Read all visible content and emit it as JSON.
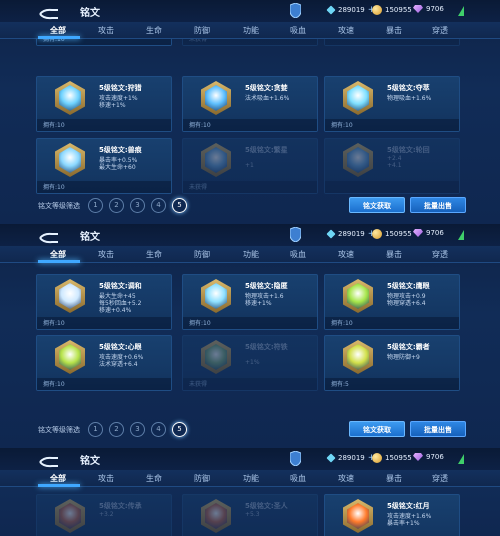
{
  "header": {
    "title": "铭文",
    "diamonds": "289019",
    "coins": "150955",
    "gems": "9706"
  },
  "tabs": [
    "全部",
    "攻击",
    "生命",
    "防御",
    "功能",
    "吸血",
    "攻速",
    "暴击",
    "穿透"
  ],
  "filter": {
    "label": "铭文等级筛选",
    "levels": [
      "1",
      "2",
      "3",
      "4",
      "5"
    ],
    "active_level": "5",
    "get_button": "铭文获取",
    "sell_button": "批量出售"
  },
  "colors": {
    "accent": "#3fa8ff",
    "bg": "#112c57"
  },
  "screens": [
    {
      "partial_row": [
        {
          "name": "",
          "stats": [],
          "owned": "拥有:10",
          "dim": false,
          "color": "#3a5f8f",
          "icon": "rune-icon"
        },
        {
          "name": "",
          "stats": [],
          "owned": "未获得",
          "dim": true,
          "color": "#3a5f8f",
          "icon": "rune-icon"
        },
        {
          "name": "",
          "stats": [
            "+4"
          ],
          "owned": "",
          "dim": true,
          "color": "#3a5f8f",
          "icon": "rune-icon"
        }
      ],
      "cards": [
        {
          "name": "5级铭文:狩猎",
          "stats": [
            "攻击速度+1%",
            "移速+1%"
          ],
          "owned": "拥有:10",
          "dim": false,
          "color": "#6fd3ff",
          "icon": "hunt-rune-icon"
        },
        {
          "name": "5级铭文:贪婪",
          "stats": [
            "法术吸血+1.6%"
          ],
          "owned": "拥有:10",
          "dim": false,
          "color": "#5ec0ff",
          "icon": "greed-rune-icon"
        },
        {
          "name": "5级铭文:夺萃",
          "stats": [
            "物理吸血+1.6%"
          ],
          "owned": "拥有:10",
          "dim": false,
          "color": "#7fe0ff",
          "icon": "plunder-rune-icon"
        },
        {
          "name": "5级铭文:兽痕",
          "stats": [
            "暴击率+0.5%",
            "最大生命+60"
          ],
          "owned": "拥有:10",
          "dim": false,
          "color": "#8bd8ff",
          "icon": "beast-rune-icon"
        },
        {
          "name": "5级铭文:繁星",
          "stats": [
            "",
            "+1"
          ],
          "owned": "未获得",
          "dim": true,
          "color": "#6aa6d8",
          "icon": "star-rune-icon"
        },
        {
          "name": "5级铭文:轮回",
          "stats": [
            "+2.4",
            "+4.1"
          ],
          "owned": "",
          "dim": true,
          "color": "#6aa6d8",
          "icon": "cycle-rune-icon"
        }
      ]
    },
    {
      "cards": [
        {
          "name": "5级铭文:调和",
          "stats": [
            "最大生命+45",
            "每5秒回血+5.2",
            "移速+0.4%"
          ],
          "owned": "拥有:10",
          "dim": false,
          "color": "#cfe9ff",
          "icon": "harmony-rune-icon"
        },
        {
          "name": "5级铭文:隐匿",
          "stats": [
            "物理攻击+1.6",
            "移速+1%"
          ],
          "owned": "拥有:10",
          "dim": false,
          "color": "#8fe1ff",
          "icon": "stealth-rune-icon"
        },
        {
          "name": "5级铭文:鹰眼",
          "stats": [
            "物理攻击+0.9",
            "物理穿透+6.4"
          ],
          "owned": "拥有:10",
          "dim": false,
          "color": "#a6e64a",
          "icon": "hawkeye-rune-icon"
        },
        {
          "name": "5级铭文:心眼",
          "stats": [
            "攻击速度+0.6%",
            "法术穿透+6.4"
          ],
          "owned": "拥有:10",
          "dim": false,
          "color": "#b7e34a",
          "icon": "mindeye-rune-icon"
        },
        {
          "name": "5级铭文:符铁",
          "stats": [
            "",
            "+1%"
          ],
          "owned": "未获得",
          "dim": true,
          "color": "#7fb07a",
          "icon": "iron-rune-icon"
        },
        {
          "name": "5级铭文:霸者",
          "stats": [
            "物理防御+9"
          ],
          "owned": "拥有:5",
          "dim": false,
          "color": "#d2e04a",
          "icon": "overlord-rune-icon"
        }
      ]
    },
    {
      "cards": [
        {
          "name": "5级铭文:传承",
          "stats": [
            "+3.2"
          ],
          "owned": "",
          "dim": true,
          "color": "#c86a4a",
          "icon": "legacy-rune-icon"
        },
        {
          "name": "5级铭文:圣人",
          "stats": [
            "+5.3"
          ],
          "owned": "",
          "dim": true,
          "color": "#c86a4a",
          "icon": "sage-rune-icon"
        },
        {
          "name": "5级铭文:红月",
          "stats": [
            "攻击速度+1.6%",
            "暴击率+1%"
          ],
          "owned": "",
          "dim": false,
          "color": "#ff7a2a",
          "icon": "redmoon-rune-icon"
        }
      ]
    }
  ]
}
